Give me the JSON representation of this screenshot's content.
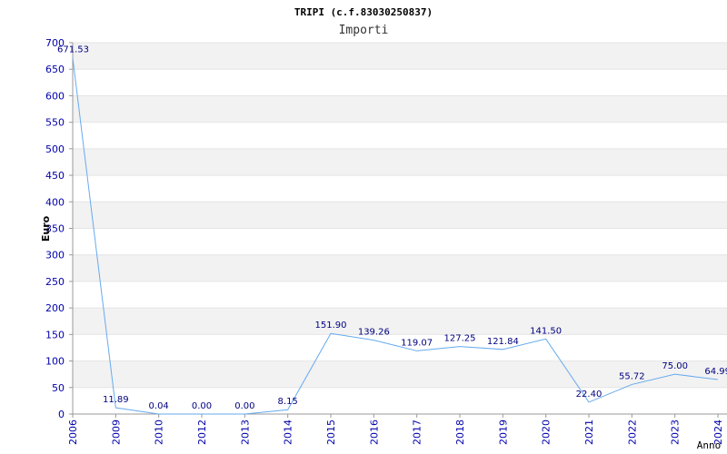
{
  "chart_data": {
    "type": "line",
    "title": "TRIPI (c.f.83030250837)",
    "subtitle": "Importi",
    "xlabel": "Anno",
    "ylabel": "Euro",
    "ylim": [
      0,
      700
    ],
    "yticks": [
      0,
      50,
      100,
      150,
      200,
      250,
      300,
      350,
      400,
      450,
      500,
      550,
      600,
      650,
      700
    ],
    "grid": true,
    "categories": [
      "2006",
      "2009",
      "2010",
      "2012",
      "2013",
      "2014",
      "2015",
      "2016",
      "2017",
      "2018",
      "2019",
      "2020",
      "2021",
      "2022",
      "2023",
      "2024"
    ],
    "values": [
      671.53,
      11.89,
      0.04,
      0.0,
      0.0,
      8.15,
      151.9,
      139.26,
      119.07,
      127.25,
      121.84,
      141.5,
      22.4,
      55.72,
      75.0,
      64.99
    ],
    "value_labels": [
      "671.53",
      "11.89",
      "0.04",
      "0.00",
      "0.00",
      "8.15",
      "151.90",
      "139.26",
      "119.07",
      "127.25",
      "121.84",
      "141.50",
      "22.40",
      "55.72",
      "75.00",
      "64.99"
    ],
    "colors": {
      "line": "#66aaee",
      "band": "#f2f2f2",
      "tick": "#0000aa",
      "label": "#000080",
      "axis": "#999999"
    }
  }
}
